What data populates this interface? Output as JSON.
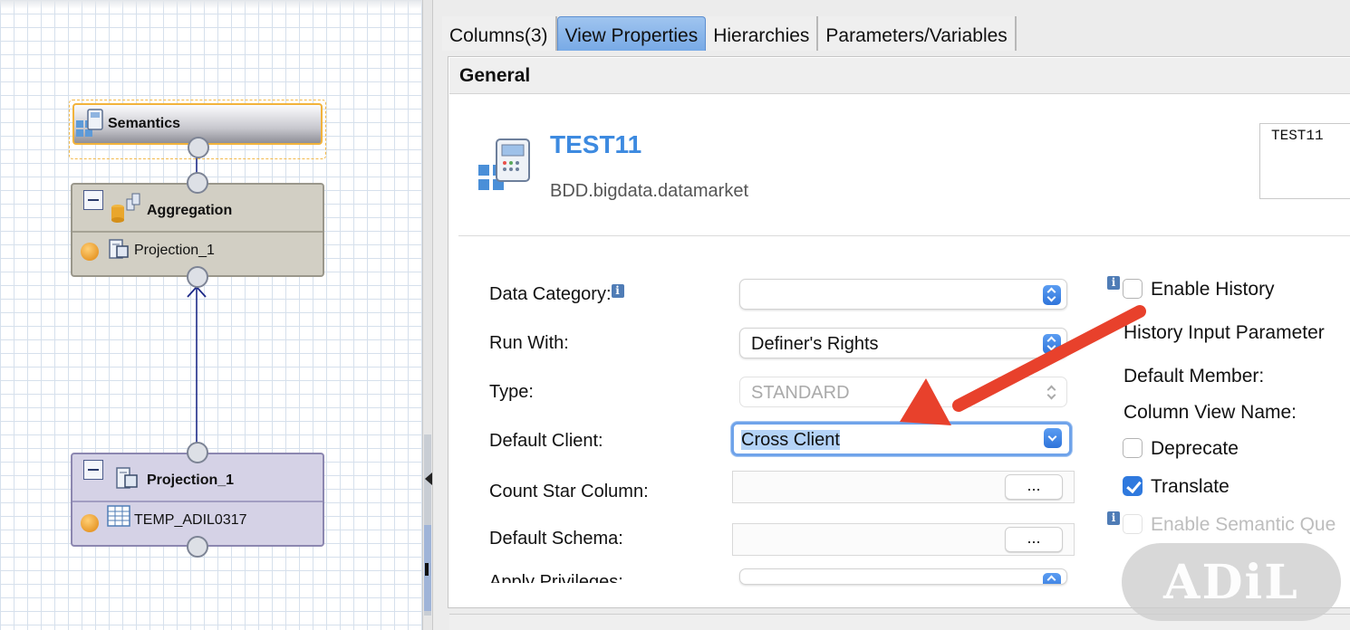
{
  "diagram": {
    "nodes": {
      "semantics": {
        "title": "Semantics"
      },
      "aggregation": {
        "title": "Aggregation",
        "input": "Projection_1"
      },
      "projection": {
        "title": "Projection_1",
        "input": "TEMP_ADIL0317"
      }
    }
  },
  "tabs": [
    "Columns(3)",
    "View Properties",
    "Hierarchies",
    "Parameters/Variables"
  ],
  "active_tab": "View Properties",
  "general": {
    "section_title": "General",
    "view_name": "TEST11",
    "package": "BDD.bigdata.datamarket",
    "description": "TEST11"
  },
  "fields": {
    "data_category": {
      "label": "Data Category:",
      "value": ""
    },
    "run_with": {
      "label": "Run With:",
      "value": "Definer's Rights"
    },
    "type": {
      "label": "Type:",
      "value": "STANDARD"
    },
    "default_client": {
      "label": "Default Client:",
      "value": "Cross Client"
    },
    "count_star_column": {
      "label": "Count Star Column:",
      "value": "",
      "button": "..."
    },
    "default_schema": {
      "label": "Default Schema:",
      "value": "",
      "button": "..."
    },
    "apply_privileges": {
      "label": "Apply Privileges:",
      "value": ""
    }
  },
  "right_options": {
    "enable_history": {
      "label": "Enable History",
      "checked": false
    },
    "history_input_parameter": "History Input Parameter",
    "default_member": "Default Member:",
    "column_view_name": "Column View Name:",
    "deprecate": {
      "label": "Deprecate",
      "checked": false
    },
    "translate": {
      "label": "Translate",
      "checked": true
    },
    "enable_semantic_query": {
      "label": "Enable Semantic Que",
      "checked": false,
      "disabled": true
    }
  },
  "info_icon_glyph": "i",
  "watermark": "ADiL",
  "colors": {
    "accent": "#3d8ae0",
    "arrow": "#e8412c",
    "tab_active": "#8cb8ec"
  }
}
